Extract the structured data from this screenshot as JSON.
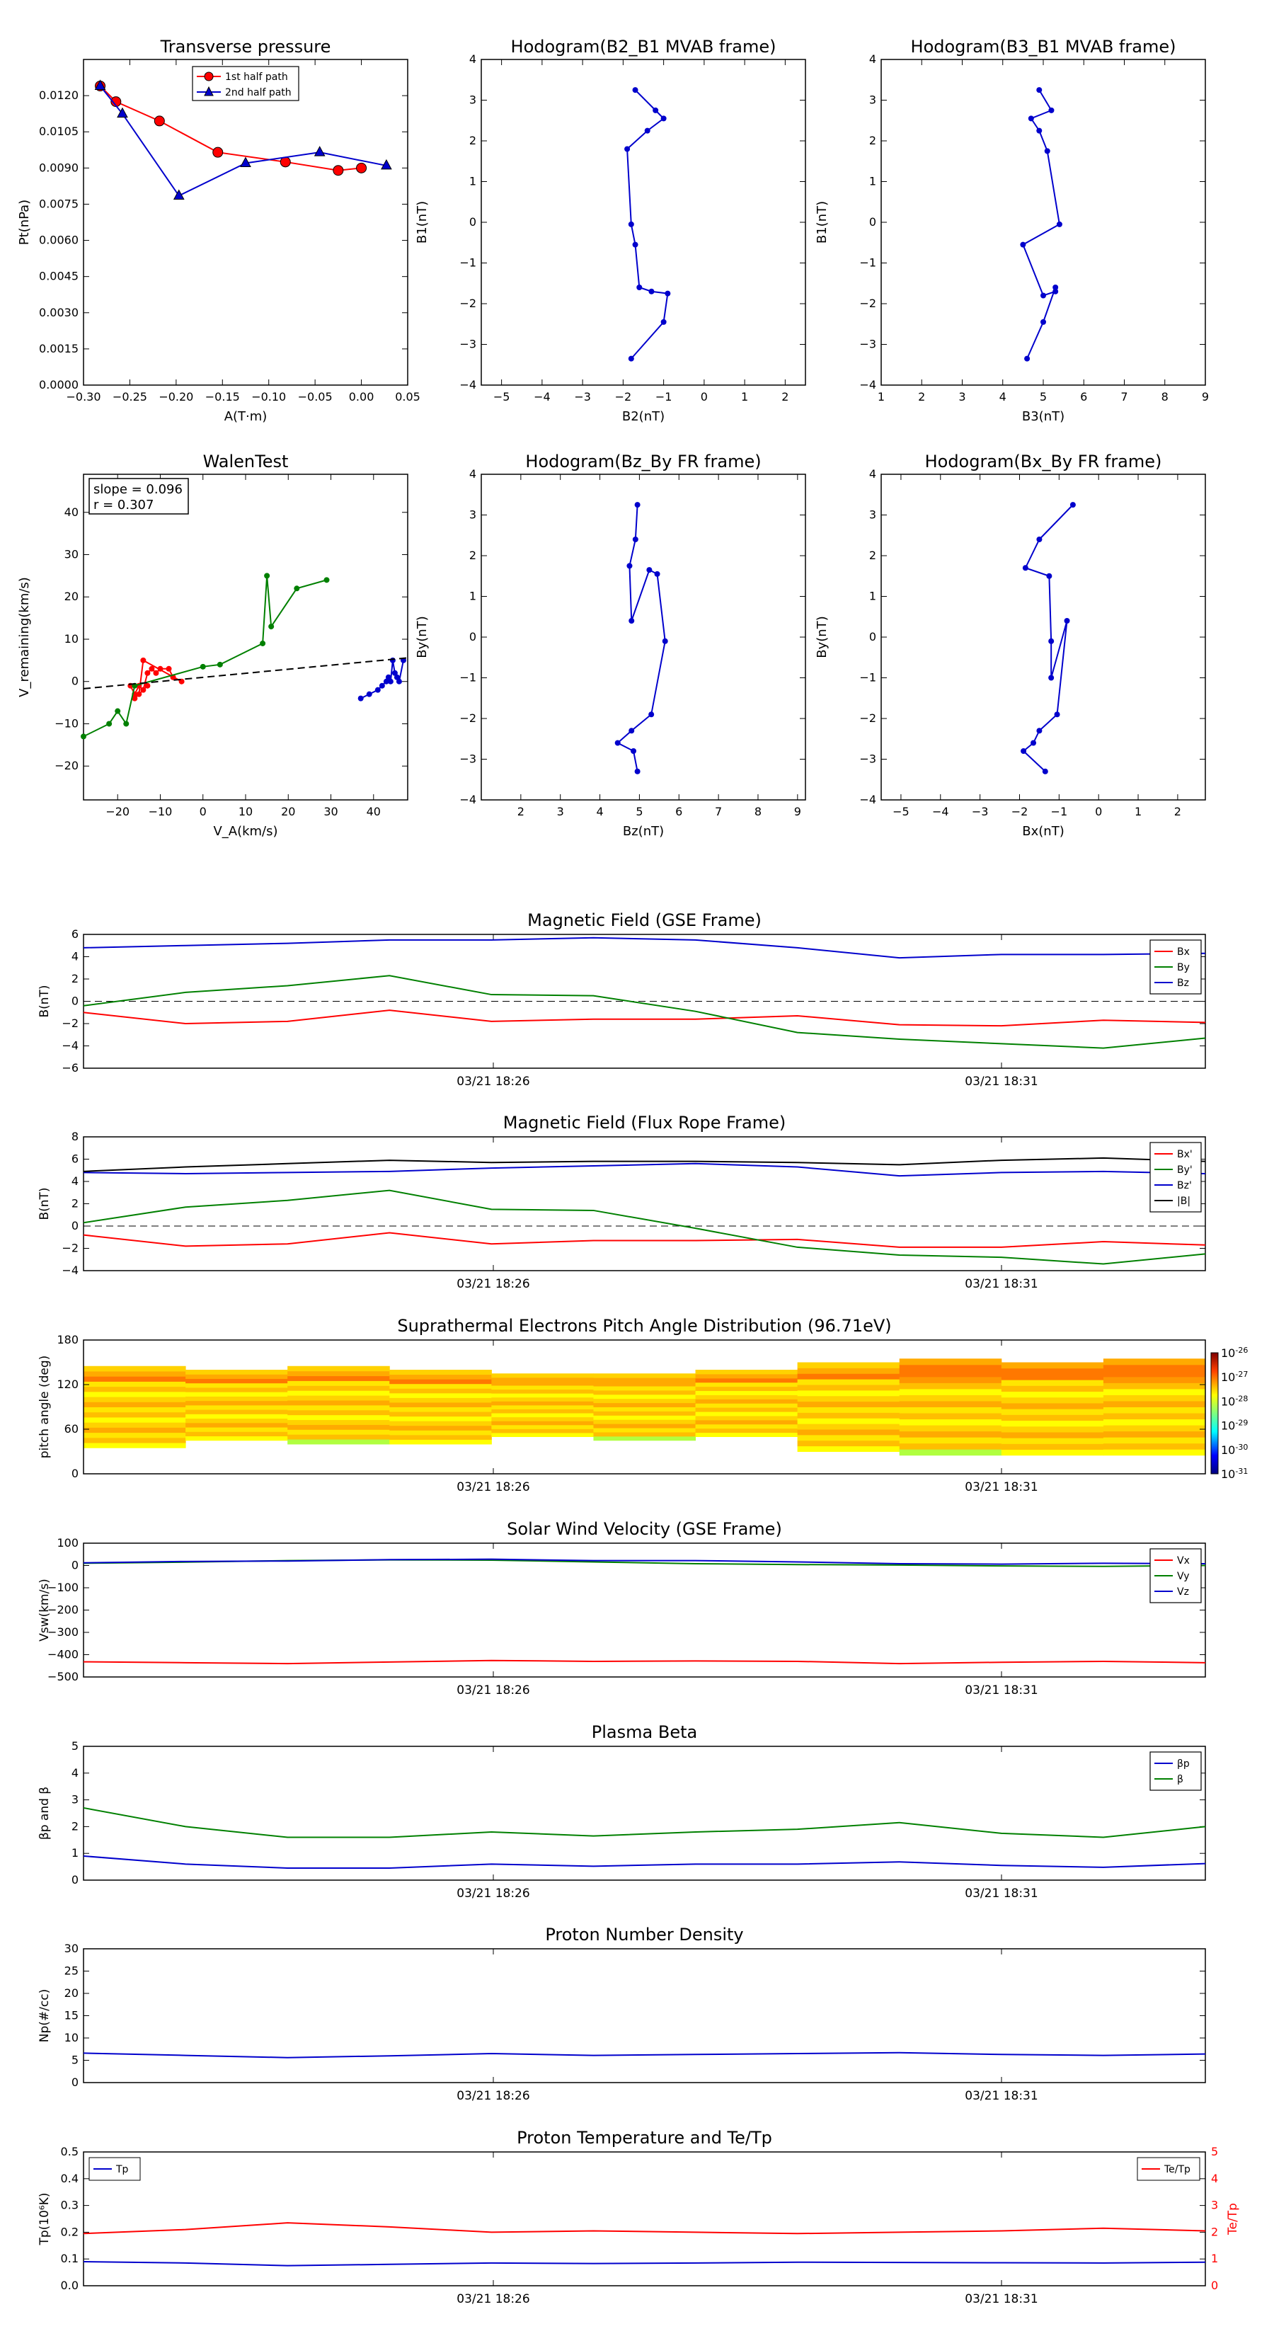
{
  "colors": {
    "red": "#ff0000",
    "green": "#008000",
    "blue": "#0000cc",
    "black": "#000000",
    "axis_right": "#ff0000"
  },
  "time_ticks": [
    "03/21 18:26",
    "03/21 18:31"
  ],
  "chart_data": [
    {
      "id": "pt",
      "type": "line",
      "title": "Transverse pressure",
      "xlabel": "A(T·m)",
      "ylabel": "Pt(nPa)",
      "xlim": [
        -0.3,
        0.05
      ],
      "ylim": [
        0.0,
        0.0135
      ],
      "xticks": [
        "−0.30",
        "−0.25",
        "−0.20",
        "−0.15",
        "−0.10",
        "−0.05",
        "0.00",
        "0.05"
      ],
      "yticks": [
        "0.0000",
        "0.0015",
        "0.0030",
        "0.0045",
        "0.0060",
        "0.0075",
        "0.0090",
        "0.0105",
        "0.0120"
      ],
      "legend": "top-center",
      "series": [
        {
          "name": "1st half path",
          "marker": "circle",
          "color": "red",
          "x": [
            -0.282,
            -0.265,
            -0.218,
            -0.155,
            -0.082,
            -0.025,
            0.0
          ],
          "y": [
            0.0124,
            0.01175,
            0.01095,
            0.00965,
            0.00925,
            0.0089,
            0.009
          ]
        },
        {
          "name": "2nd half path",
          "marker": "triangle",
          "color": "blue",
          "x": [
            -0.282,
            -0.258,
            -0.197,
            -0.125,
            -0.045,
            0.027
          ],
          "y": [
            0.0124,
            0.01125,
            0.00785,
            0.0092,
            0.00965,
            0.0091
          ]
        }
      ]
    },
    {
      "id": "h1",
      "type": "line",
      "title": "Hodogram(B2_B1 MVAB frame)",
      "xlabel": "B2(nT)",
      "ylabel": "B1(nT)",
      "xlim": [
        -5.5,
        2.5
      ],
      "ylim": [
        -4,
        4
      ],
      "xticks": [
        "−5",
        "−4",
        "−3",
        "−2",
        "−1",
        "0",
        "1",
        "2"
      ],
      "yticks": [
        "−4",
        "−3",
        "−2",
        "−1",
        "0",
        "1",
        "2",
        "3",
        "4"
      ],
      "series": [
        {
          "color": "blue",
          "x": [
            -1.7,
            -1.2,
            -1.0,
            -1.4,
            -1.9,
            -1.8,
            -1.7,
            -1.6,
            -1.3,
            -0.9,
            -1.0,
            -1.8
          ],
          "y": [
            3.25,
            2.75,
            2.55,
            2.25,
            1.8,
            -0.05,
            -0.55,
            -1.6,
            -1.7,
            -1.75,
            -2.45,
            -3.35
          ]
        }
      ]
    },
    {
      "id": "h2",
      "type": "line",
      "title": "Hodogram(B3_B1 MVAB frame)",
      "xlabel": "B3(nT)",
      "ylabel": "B1(nT)",
      "xlim": [
        1,
        9
      ],
      "ylim": [
        -4,
        4
      ],
      "xticks": [
        "1",
        "2",
        "3",
        "4",
        "5",
        "6",
        "7",
        "8",
        "9"
      ],
      "yticks": [
        "−4",
        "−3",
        "−2",
        "−1",
        "0",
        "1",
        "2",
        "3",
        "4"
      ],
      "series": [
        {
          "color": "blue",
          "x": [
            4.9,
            5.2,
            4.7,
            4.9,
            5.1,
            5.4,
            4.5,
            5.0,
            5.3,
            5.3,
            5.0,
            4.6
          ],
          "y": [
            3.25,
            2.75,
            2.55,
            2.25,
            1.75,
            -0.05,
            -0.55,
            -1.8,
            -1.7,
            -1.6,
            -2.45,
            -3.35
          ]
        }
      ]
    },
    {
      "id": "walen",
      "type": "scatter",
      "title": "WalenTest",
      "xlabel": "V_A(km/s)",
      "ylabel": "V_remaining(km/s)",
      "xlim": [
        -28,
        48
      ],
      "ylim": [
        -28,
        49
      ],
      "xticks": [
        "−20",
        "−10",
        "0",
        "10",
        "20",
        "30",
        "40"
      ],
      "yticks": [
        "−20",
        "−10",
        "0",
        "10",
        "20",
        "30",
        "40"
      ],
      "annotation": [
        "slope = 0.096",
        "r = 0.307"
      ],
      "fit": {
        "slope": 0.096,
        "intercept": 0.98
      },
      "series": [
        {
          "color": "red",
          "x": [
            -17,
            -16,
            -15,
            -14,
            -13,
            -12,
            -11,
            -10,
            -8,
            -7,
            -5,
            -14,
            -15,
            -16,
            -13
          ],
          "y": [
            -1,
            -3,
            -1,
            -2,
            2,
            3,
            2,
            3,
            3,
            1,
            0,
            5,
            -3,
            -4,
            -1
          ]
        },
        {
          "color": "green",
          "x": [
            -28,
            -22,
            -20,
            -18,
            -16,
            0,
            4,
            14,
            15,
            16,
            22,
            29
          ],
          "y": [
            -13,
            -10,
            -7,
            -10,
            -1,
            3.5,
            4,
            9,
            25,
            13,
            22,
            24
          ]
        },
        {
          "color": "blue",
          "x": [
            37,
            39,
            41,
            42,
            43,
            43.5,
            44,
            44.5,
            45,
            45.5,
            46,
            47
          ],
          "y": [
            -4,
            -3,
            -2,
            -1,
            0,
            1,
            0,
            5,
            2,
            1,
            0,
            5
          ]
        }
      ]
    },
    {
      "id": "h3",
      "type": "line",
      "title": "Hodogram(Bz_By FR frame)",
      "xlabel": "Bz(nT)",
      "ylabel": "By(nT)",
      "xlim": [
        1,
        9.2
      ],
      "ylim": [
        -4,
        4
      ],
      "xticks": [
        "2",
        "3",
        "4",
        "5",
        "6",
        "7",
        "8",
        "9"
      ],
      "yticks": [
        "−4",
        "−3",
        "−2",
        "−1",
        "0",
        "1",
        "2",
        "3",
        "4"
      ],
      "series": [
        {
          "color": "blue",
          "x": [
            4.95,
            4.9,
            4.75,
            4.8,
            5.25,
            5.45,
            5.65,
            5.3,
            4.8,
            4.45,
            4.85,
            4.95
          ],
          "y": [
            3.25,
            2.4,
            1.75,
            0.4,
            1.65,
            1.55,
            -0.1,
            -1.9,
            -2.3,
            -2.6,
            -2.8,
            -3.3
          ]
        }
      ]
    },
    {
      "id": "h4",
      "type": "line",
      "title": "Hodogram(Bx_By FR frame)",
      "xlabel": "Bx(nT)",
      "ylabel": "By(nT)",
      "xlim": [
        -5.5,
        2.7
      ],
      "ylim": [
        -4,
        4
      ],
      "xticks": [
        "−5",
        "−4",
        "−3",
        "−2",
        "−1",
        "0",
        "1",
        "2"
      ],
      "yticks": [
        "−4",
        "−3",
        "−2",
        "−1",
        "0",
        "1",
        "2",
        "3",
        "4"
      ],
      "series": [
        {
          "color": "blue",
          "x": [
            -0.65,
            -1.5,
            -1.85,
            -1.25,
            -1.2,
            -1.2,
            -0.8,
            -1.05,
            -1.5,
            -1.65,
            -1.9,
            -1.35
          ],
          "y": [
            3.25,
            2.4,
            1.7,
            1.5,
            -0.1,
            -1.0,
            0.4,
            -1.9,
            -2.3,
            -2.6,
            -2.8,
            -3.3
          ]
        }
      ]
    },
    {
      "id": "bgse",
      "type": "line",
      "title": "Magnetic Field (GSE Frame)",
      "ylabel": "B(nT)",
      "ylim": [
        -6,
        6
      ],
      "yticks": [
        "−6",
        "−4",
        "−2",
        "0",
        "2",
        "4",
        "6"
      ],
      "zero_line": true,
      "legend": "right",
      "series": [
        {
          "name": "Bx",
          "color": "red",
          "values": [
            -1.0,
            -2.0,
            -1.8,
            -0.8,
            -1.8,
            -1.6,
            -1.6,
            -1.3,
            -2.1,
            -2.2,
            -1.7,
            -1.9
          ]
        },
        {
          "name": "By",
          "color": "green",
          "values": [
            -0.4,
            0.8,
            1.4,
            2.3,
            0.6,
            0.5,
            -0.9,
            -2.8,
            -3.4,
            -3.8,
            -4.2,
            -3.3
          ]
        },
        {
          "name": "Bz",
          "color": "blue",
          "values": [
            4.8,
            5.0,
            5.2,
            5.5,
            5.5,
            5.7,
            5.5,
            4.8,
            3.9,
            4.2,
            4.2,
            4.3
          ]
        }
      ]
    },
    {
      "id": "bfr",
      "type": "line",
      "title": "Magnetic Field (Flux Rope Frame)",
      "ylabel": "B(nT)",
      "ylim": [
        -4,
        8
      ],
      "yticks": [
        "−4",
        "−2",
        "0",
        "2",
        "4",
        "6",
        "8"
      ],
      "zero_line": true,
      "legend": "right",
      "series": [
        {
          "name": "Bx'",
          "color": "red",
          "values": [
            -0.8,
            -1.8,
            -1.6,
            -0.6,
            -1.6,
            -1.3,
            -1.3,
            -1.2,
            -1.9,
            -1.9,
            -1.4,
            -1.7
          ]
        },
        {
          "name": "By'",
          "color": "green",
          "values": [
            0.3,
            1.7,
            2.3,
            3.2,
            1.5,
            1.4,
            -0.2,
            -1.9,
            -2.6,
            -2.8,
            -3.4,
            -2.5
          ]
        },
        {
          "name": "Bz'",
          "color": "blue",
          "values": [
            4.8,
            4.7,
            4.8,
            4.9,
            5.2,
            5.4,
            5.6,
            5.3,
            4.5,
            4.8,
            4.9,
            4.7
          ]
        },
        {
          "name": "|B|",
          "color": "black",
          "values": [
            4.9,
            5.3,
            5.6,
            5.9,
            5.7,
            5.8,
            5.8,
            5.7,
            5.5,
            5.9,
            6.1,
            5.8
          ]
        }
      ]
    },
    {
      "id": "pad",
      "type": "heatmap",
      "title": "Suprathermal Electrons Pitch Angle Distribution (96.71eV)",
      "ylabel": "pitch angle (deg)",
      "ylim": [
        0,
        180
      ],
      "yticks": [
        "0",
        "60",
        "120",
        "180"
      ],
      "colorbar_ticks": [
        "10-26",
        "10-27",
        "10-28",
        "10-29",
        "10-30",
        "10-31"
      ]
    },
    {
      "id": "vsw",
      "type": "line",
      "title": "Solar Wind Velocity (GSE Frame)",
      "ylabel": "Vsw(km/s)",
      "ylim": [
        -500,
        100
      ],
      "yticks": [
        "−500",
        "−400",
        "−300",
        "−200",
        "−100",
        "0",
        "100"
      ],
      "legend": "right",
      "series": [
        {
          "name": "Vx",
          "color": "red",
          "values": [
            -432,
            -436,
            -440,
            -433,
            -426,
            -430,
            -428,
            -430,
            -440,
            -434,
            -430,
            -436
          ]
        },
        {
          "name": "Vy",
          "color": "green",
          "values": [
            10,
            15,
            22,
            25,
            24,
            16,
            8,
            4,
            2,
            -2,
            -4,
            0
          ]
        },
        {
          "name": "Vz",
          "color": "blue",
          "values": [
            12,
            18,
            20,
            26,
            28,
            22,
            22,
            16,
            8,
            6,
            10,
            8
          ]
        }
      ]
    },
    {
      "id": "beta",
      "type": "line",
      "title": "Plasma Beta",
      "ylabel": "βp and β",
      "ylim": [
        0,
        5
      ],
      "yticks": [
        "0",
        "1",
        "2",
        "3",
        "4",
        "5"
      ],
      "legend": "right",
      "series": [
        {
          "name": "βp",
          "color": "blue",
          "values": [
            0.9,
            0.6,
            0.45,
            0.45,
            0.6,
            0.52,
            0.6,
            0.6,
            0.68,
            0.55,
            0.48,
            0.62
          ]
        },
        {
          "name": "β",
          "color": "green",
          "values": [
            2.7,
            2.0,
            1.6,
            1.6,
            1.8,
            1.65,
            1.8,
            1.9,
            2.15,
            1.75,
            1.6,
            2.0
          ]
        }
      ]
    },
    {
      "id": "np",
      "type": "line",
      "title": "Proton Number Density",
      "ylabel": "Np(#/cc)",
      "ylim": [
        0,
        30
      ],
      "yticks": [
        "0",
        "5",
        "10",
        "15",
        "20",
        "25",
        "30"
      ],
      "series": [
        {
          "name": "Np",
          "color": "blue",
          "values": [
            6.6,
            6.1,
            5.6,
            6.0,
            6.5,
            6.1,
            6.3,
            6.5,
            6.7,
            6.3,
            6.1,
            6.4
          ]
        }
      ]
    },
    {
      "id": "tp",
      "type": "line",
      "title": "Proton Temperature and Te/Tp",
      "ylabel": "Tp(10⁶K)",
      "y2label": "Te/Tp",
      "ylim": [
        0,
        0.5
      ],
      "yticks": [
        "0.0",
        "0.1",
        "0.2",
        "0.3",
        "0.4",
        "0.5"
      ],
      "y2lim": [
        0,
        5
      ],
      "y2ticks": [
        "0",
        "1",
        "2",
        "3",
        "4",
        "5"
      ],
      "legend": "top-left",
      "series": [
        {
          "name": "Tp",
          "color": "blue",
          "axis": "left",
          "values": [
            0.09,
            0.085,
            0.075,
            0.08,
            0.085,
            0.083,
            0.085,
            0.088,
            0.087,
            0.086,
            0.085,
            0.088
          ]
        },
        {
          "name": "Te/Tp",
          "color": "red",
          "axis": "right",
          "values": [
            1.95,
            2.1,
            2.35,
            2.2,
            2.0,
            2.05,
            2.0,
            1.95,
            2.0,
            2.05,
            2.15,
            2.05
          ]
        }
      ]
    }
  ]
}
